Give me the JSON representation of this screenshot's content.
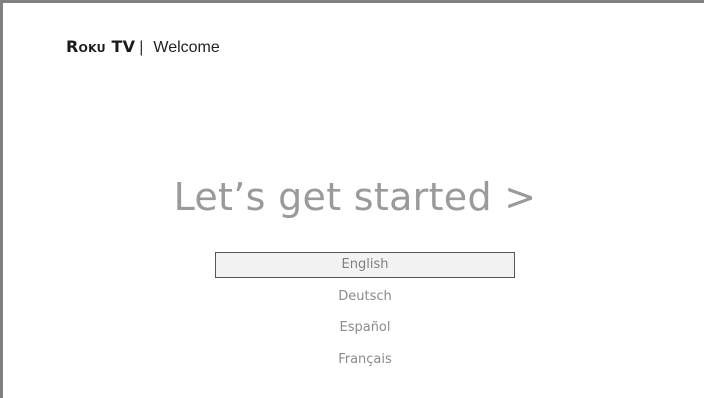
{
  "header": {
    "brand_roku": "Roku",
    "brand_tv": "TV",
    "divider": "|",
    "title": "Welcome"
  },
  "hero": {
    "text": "Let’s get started >"
  },
  "languages": {
    "selected_index": 0,
    "items": [
      {
        "label": "English"
      },
      {
        "label": "Deutsch"
      },
      {
        "label": "Español"
      },
      {
        "label": "Français"
      }
    ]
  },
  "colors": {
    "frame_border": "#808080",
    "hero_text": "#9a9a9a",
    "option_text": "#8a8a8a",
    "selected_bg": "#f2f2f2"
  }
}
